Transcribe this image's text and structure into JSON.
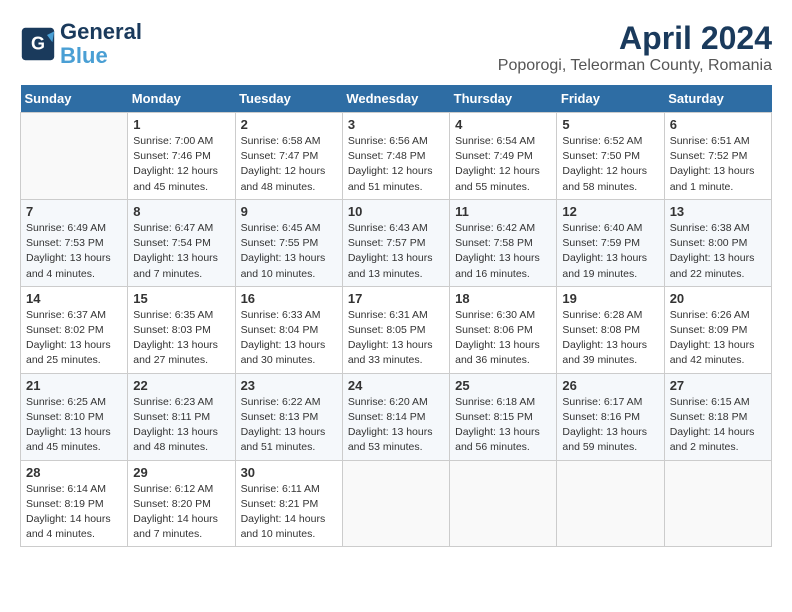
{
  "header": {
    "logo_line1": "General",
    "logo_line2": "Blue",
    "month": "April 2024",
    "location": "Poporogi, Teleorman County, Romania"
  },
  "weekdays": [
    "Sunday",
    "Monday",
    "Tuesday",
    "Wednesday",
    "Thursday",
    "Friday",
    "Saturday"
  ],
  "weeks": [
    [
      {
        "day": "",
        "info": ""
      },
      {
        "day": "1",
        "info": "Sunrise: 7:00 AM\nSunset: 7:46 PM\nDaylight: 12 hours\nand 45 minutes."
      },
      {
        "day": "2",
        "info": "Sunrise: 6:58 AM\nSunset: 7:47 PM\nDaylight: 12 hours\nand 48 minutes."
      },
      {
        "day": "3",
        "info": "Sunrise: 6:56 AM\nSunset: 7:48 PM\nDaylight: 12 hours\nand 51 minutes."
      },
      {
        "day": "4",
        "info": "Sunrise: 6:54 AM\nSunset: 7:49 PM\nDaylight: 12 hours\nand 55 minutes."
      },
      {
        "day": "5",
        "info": "Sunrise: 6:52 AM\nSunset: 7:50 PM\nDaylight: 12 hours\nand 58 minutes."
      },
      {
        "day": "6",
        "info": "Sunrise: 6:51 AM\nSunset: 7:52 PM\nDaylight: 13 hours\nand 1 minute."
      }
    ],
    [
      {
        "day": "7",
        "info": "Sunrise: 6:49 AM\nSunset: 7:53 PM\nDaylight: 13 hours\nand 4 minutes."
      },
      {
        "day": "8",
        "info": "Sunrise: 6:47 AM\nSunset: 7:54 PM\nDaylight: 13 hours\nand 7 minutes."
      },
      {
        "day": "9",
        "info": "Sunrise: 6:45 AM\nSunset: 7:55 PM\nDaylight: 13 hours\nand 10 minutes."
      },
      {
        "day": "10",
        "info": "Sunrise: 6:43 AM\nSunset: 7:57 PM\nDaylight: 13 hours\nand 13 minutes."
      },
      {
        "day": "11",
        "info": "Sunrise: 6:42 AM\nSunset: 7:58 PM\nDaylight: 13 hours\nand 16 minutes."
      },
      {
        "day": "12",
        "info": "Sunrise: 6:40 AM\nSunset: 7:59 PM\nDaylight: 13 hours\nand 19 minutes."
      },
      {
        "day": "13",
        "info": "Sunrise: 6:38 AM\nSunset: 8:00 PM\nDaylight: 13 hours\nand 22 minutes."
      }
    ],
    [
      {
        "day": "14",
        "info": "Sunrise: 6:37 AM\nSunset: 8:02 PM\nDaylight: 13 hours\nand 25 minutes."
      },
      {
        "day": "15",
        "info": "Sunrise: 6:35 AM\nSunset: 8:03 PM\nDaylight: 13 hours\nand 27 minutes."
      },
      {
        "day": "16",
        "info": "Sunrise: 6:33 AM\nSunset: 8:04 PM\nDaylight: 13 hours\nand 30 minutes."
      },
      {
        "day": "17",
        "info": "Sunrise: 6:31 AM\nSunset: 8:05 PM\nDaylight: 13 hours\nand 33 minutes."
      },
      {
        "day": "18",
        "info": "Sunrise: 6:30 AM\nSunset: 8:06 PM\nDaylight: 13 hours\nand 36 minutes."
      },
      {
        "day": "19",
        "info": "Sunrise: 6:28 AM\nSunset: 8:08 PM\nDaylight: 13 hours\nand 39 minutes."
      },
      {
        "day": "20",
        "info": "Sunrise: 6:26 AM\nSunset: 8:09 PM\nDaylight: 13 hours\nand 42 minutes."
      }
    ],
    [
      {
        "day": "21",
        "info": "Sunrise: 6:25 AM\nSunset: 8:10 PM\nDaylight: 13 hours\nand 45 minutes."
      },
      {
        "day": "22",
        "info": "Sunrise: 6:23 AM\nSunset: 8:11 PM\nDaylight: 13 hours\nand 48 minutes."
      },
      {
        "day": "23",
        "info": "Sunrise: 6:22 AM\nSunset: 8:13 PM\nDaylight: 13 hours\nand 51 minutes."
      },
      {
        "day": "24",
        "info": "Sunrise: 6:20 AM\nSunset: 8:14 PM\nDaylight: 13 hours\nand 53 minutes."
      },
      {
        "day": "25",
        "info": "Sunrise: 6:18 AM\nSunset: 8:15 PM\nDaylight: 13 hours\nand 56 minutes."
      },
      {
        "day": "26",
        "info": "Sunrise: 6:17 AM\nSunset: 8:16 PM\nDaylight: 13 hours\nand 59 minutes."
      },
      {
        "day": "27",
        "info": "Sunrise: 6:15 AM\nSunset: 8:18 PM\nDaylight: 14 hours\nand 2 minutes."
      }
    ],
    [
      {
        "day": "28",
        "info": "Sunrise: 6:14 AM\nSunset: 8:19 PM\nDaylight: 14 hours\nand 4 minutes."
      },
      {
        "day": "29",
        "info": "Sunrise: 6:12 AM\nSunset: 8:20 PM\nDaylight: 14 hours\nand 7 minutes."
      },
      {
        "day": "30",
        "info": "Sunrise: 6:11 AM\nSunset: 8:21 PM\nDaylight: 14 hours\nand 10 minutes."
      },
      {
        "day": "",
        "info": ""
      },
      {
        "day": "",
        "info": ""
      },
      {
        "day": "",
        "info": ""
      },
      {
        "day": "",
        "info": ""
      }
    ]
  ]
}
